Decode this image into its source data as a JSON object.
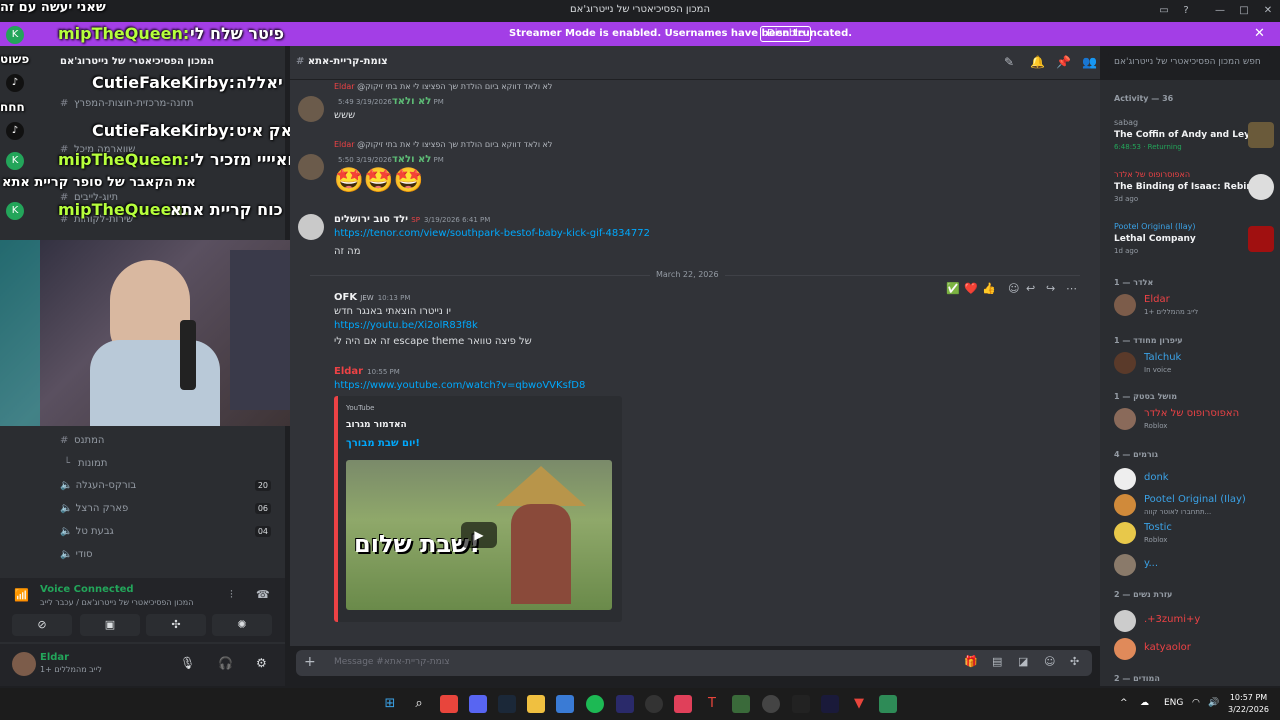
{
  "window": {
    "title": "המכון הפסיכיאטרי של נייטרוג'אם",
    "overlay_top_text": "שאני יעשה עם זה"
  },
  "banner": {
    "message": "Streamer Mode is enabled. Usernames have been truncated.",
    "disable_label": "Disable",
    "close": "✕"
  },
  "overlay_chat": [
    {
      "user": "mipTheQueen:",
      "text": "פיטר שלח לי",
      "platform": "kick"
    },
    {
      "user": "CutieFakeKirby:",
      "text": "יאללה",
      "platform": "tiktok"
    },
    {
      "user": "CutieFakeKirby:",
      "text": "פאק איט",
      "platform": "tiktok"
    },
    {
      "user": "mipTheQueen:",
      "text": "ואיייי מזכיר לי",
      "platform": "kick"
    },
    {
      "user": "",
      "text": "את הקאבר של סופר קריית אתא",
      "platform": ""
    },
    {
      "user": "mipTheQueen:",
      "text": "כוח קריית אתא",
      "platform": "kick"
    }
  ],
  "overlay_side_labels": [
    "פשוט",
    "חחח"
  ],
  "sidebar": {
    "server_name": "המכון הפסיכיאטרי של נייטרוג'אם",
    "channels_top": [
      "תחנה-מרכזית-חוצות-המפרץ",
      "שווארמה מיכל",
      "תיוג-לייבים",
      "שירות-לקוחות"
    ],
    "channels": [
      {
        "name": "המתנס",
        "type": "text"
      },
      {
        "name": "תמונות",
        "type": "thread"
      }
    ],
    "voice_channels": [
      {
        "name": "בורקס-העגלה",
        "count": "20"
      },
      {
        "name": "פארק הרצל",
        "count": "06"
      },
      {
        "name": "גבעת טל",
        "count": "04"
      },
      {
        "name": "סודי",
        "count": ""
      }
    ]
  },
  "voice": {
    "status": "Voice Connected",
    "location": "המכון הפסיכיאטרי של נייטרוג'אם / עכבר לייב"
  },
  "user": {
    "name": "Eldar",
    "status": "לייב מהמללים +1"
  },
  "chat": {
    "channel": "צומת-קריית-אתא",
    "composer_placeholder": "Message #צומת-קריית-אתא",
    "search_placeholder": "חפש המכון הפסיכיאטרי של נייטרוג'אם",
    "date_divider": "March 22, 2026",
    "messages": [
      {
        "reply": "@לא ולאד דווקא ביום הולדת שך הפציצו לי את בתי זיקוק",
        "reply_author": "Eldar",
        "author": "לא ולאד",
        "time": "3/19/2026 5:49 PM",
        "text": "ששש",
        "color": "#5dbd76"
      },
      {
        "reply": "@לא ולאד דווקא ביום הולדת שך הפציצו לי את בתי זיקוק",
        "reply_author": "Eldar",
        "author": "לא ולאד",
        "time": "3/19/2026 5:50 PM",
        "text": "🤩🤩🤩",
        "color": "#5dbd76"
      },
      {
        "author": "ילד סוב ירושלים",
        "badge": "SP",
        "time": "3/19/2026 6:41 PM",
        "link": "https://tenor.com/view/southpark-bestof-baby-kick-gif-4834772",
        "text": "מה זה",
        "color": "#f2f3f5"
      },
      {
        "author": "OFK",
        "badge": "JEW",
        "time": "10:13 PM",
        "text": "יו נייטרו הוצאתי באנגר חדש",
        "link": "https://youtu.be/Xi2olR83f8k",
        "text2": "זה אם היה לי escape theme של פיצה טוואר",
        "color": "#f2f3f5"
      },
      {
        "author": "Eldar",
        "time": "10:55 PM",
        "link": "https://www.youtube.com/watch?v=qbwoVVKsfD8",
        "color": "#ed4245"
      }
    ],
    "embed": {
      "provider": "YouTube",
      "author": "האדמור מגרוב",
      "title": "יום שבת מבורך!",
      "thumb_caption": "שבת שלום!"
    },
    "reactions": [
      "✅",
      "❤️",
      "👍"
    ]
  },
  "members": {
    "activity_header": "Activity — 36",
    "activities": [
      {
        "who": "sabag",
        "game": "The Coffin of Andy and Ley...",
        "time": "6:48:53 · Returning",
        "color": "#6a5a3a"
      },
      {
        "who": "האפוסרופוס של אלדר",
        "game": "The Binding of Isaac: Rebirth",
        "time": "3d ago",
        "color": "#ddd"
      },
      {
        "who": "Pootel Original (Ilay)",
        "game": "Lethal Company",
        "time": "1d ago",
        "color": "#a01010"
      }
    ],
    "groups": [
      {
        "label": "אלדר — 1",
        "items": [
          {
            "name": "Eldar",
            "sub": "לייב מהמללים +1",
            "color": "#ed4245",
            "av": "#7c5c4a"
          }
        ]
      },
      {
        "label": "עיפרון מחודד — 1",
        "items": [
          {
            "name": "Talchuk",
            "sub": "In voice",
            "color": "#3ba2e6",
            "av": "#5a3a2a"
          }
        ]
      },
      {
        "label": "מושל בסטק — 1",
        "items": [
          {
            "name": "האפוסרופוס של אלדר",
            "sub": "Roblox",
            "color": "#ed4245",
            "av": "#8a6a5a"
          }
        ]
      },
      {
        "label": "גורמים — 4",
        "items": [
          {
            "name": "donk",
            "sub": "",
            "color": "#3ba2e6",
            "av": "#eee"
          },
          {
            "name": "Pootel Original (Ilay)",
            "sub": "תתחברו לאוטר קווה...",
            "color": "#3ba2e6",
            "av": "#d08a3a"
          },
          {
            "name": "Tostic",
            "sub": "Roblox",
            "color": "#3ba2e6",
            "av": "#e8c84a"
          },
          {
            "name": "y...",
            "sub": "",
            "color": "#3ba2e6",
            "av": "#8a7a6a"
          }
        ]
      },
      {
        "label": "עזרת נשים — 2",
        "items": [
          {
            "name": ".+3zumi+y",
            "sub": "",
            "color": "#ed4245",
            "av": "#ccc"
          },
          {
            "name": "katyaolor",
            "sub": "",
            "color": "#ed4245",
            "av": "#e08a5a"
          }
        ]
      },
      {
        "label": "המודים — 2",
        "items": []
      }
    ]
  },
  "taskbar": {
    "lang": "ENG",
    "time": "10:57 PM",
    "date": "3/22/2026"
  }
}
